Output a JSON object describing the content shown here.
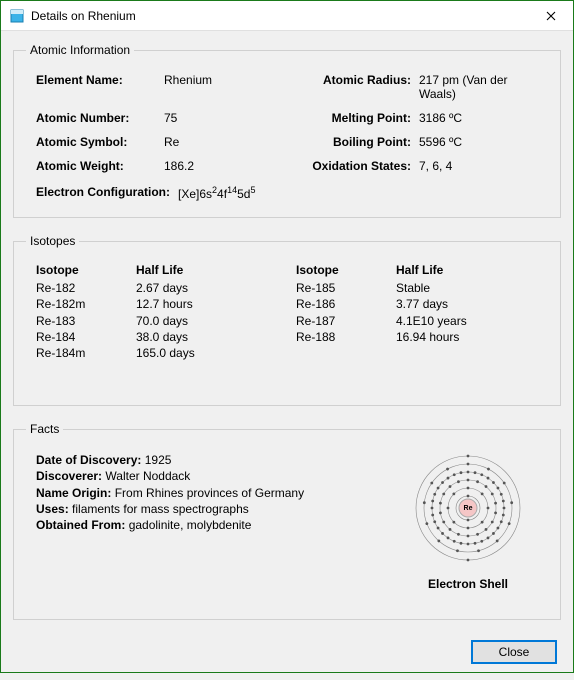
{
  "window": {
    "title": "Details on Rhenium",
    "close_x": "✕"
  },
  "atomic": {
    "legend": "Atomic Information",
    "labels": {
      "element_name": "Element Name:",
      "atomic_number": "Atomic Number:",
      "atomic_symbol": "Atomic Symbol:",
      "atomic_weight": "Atomic Weight:",
      "atomic_radius": "Atomic Radius:",
      "melting_point": "Melting Point:",
      "boiling_point": "Boiling Point:",
      "oxidation_states": "Oxidation States:",
      "electron_config": "Electron Configuration:"
    },
    "values": {
      "element_name": "Rhenium",
      "atomic_number": "75",
      "atomic_symbol": "Re",
      "atomic_weight": "186.2",
      "atomic_radius": "217 pm (Van der Waals)",
      "melting_point": "3186 ºC",
      "boiling_point": "5596 ºC",
      "oxidation_states": "7, 6, 4",
      "electron_config_html": "[Xe]6s<sup>2</sup>4f<sup>14</sup>5d<sup>5</sup>"
    }
  },
  "isotopes": {
    "legend": "Isotopes",
    "headers": {
      "isotope": "Isotope",
      "halflife": "Half Life"
    },
    "left": [
      {
        "name": "Re-182",
        "hl": "2.67 days"
      },
      {
        "name": "Re-182m",
        "hl": "12.7 hours"
      },
      {
        "name": "Re-183",
        "hl": "70.0 days"
      },
      {
        "name": "Re-184",
        "hl": "38.0 days"
      },
      {
        "name": "Re-184m",
        "hl": "165.0 days"
      }
    ],
    "right": [
      {
        "name": "Re-185",
        "hl": "Stable"
      },
      {
        "name": "Re-186",
        "hl": "3.77 days"
      },
      {
        "name": "Re-187",
        "hl": "4.1E10 years"
      },
      {
        "name": "Re-188",
        "hl": "16.94 hours"
      }
    ]
  },
  "facts": {
    "legend": "Facts",
    "labels": {
      "discovery": "Date of Discovery:",
      "discoverer": "Discoverer:",
      "name_origin": "Name Origin:",
      "uses": "Uses:",
      "obtained": "Obtained From:"
    },
    "values": {
      "discovery": "1925",
      "discoverer": "Walter Noddack",
      "name_origin": "From Rhines provinces of Germany",
      "uses": "filaments for mass spectrographs",
      "obtained": "gadolinite, molybdenite"
    },
    "shell_caption": "Electron Shell",
    "shell_symbol": "Re"
  },
  "buttons": {
    "close": "Close"
  }
}
